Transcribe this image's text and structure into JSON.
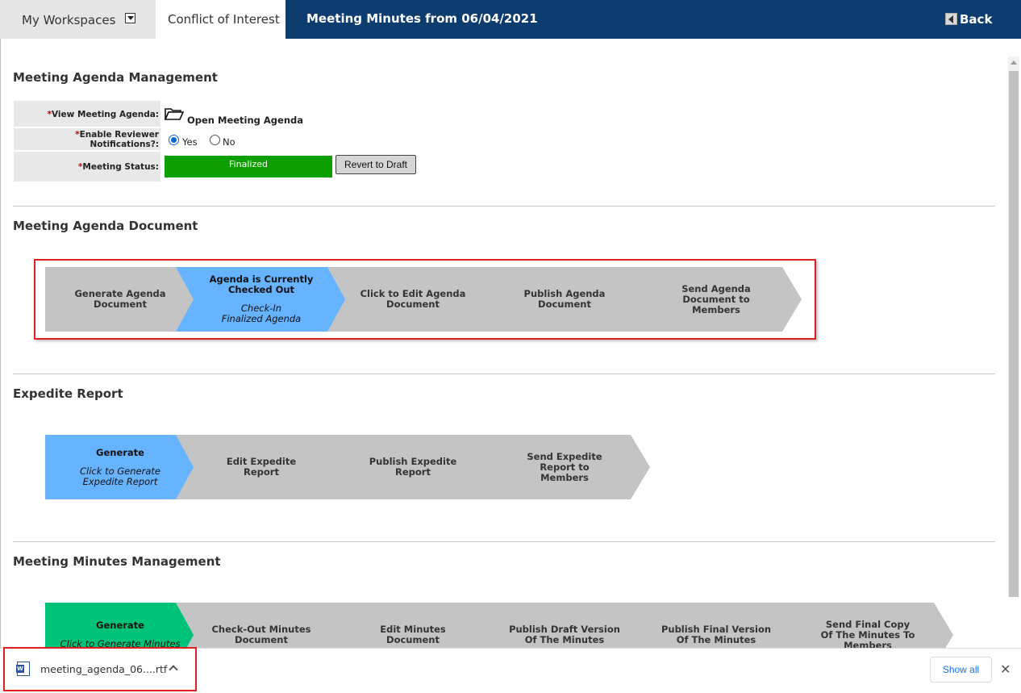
{
  "header": {
    "workspaces_label": "My Workspaces",
    "tab_label": "Conflict of Interest",
    "page_title": "Meeting Minutes from 06/04/2021",
    "back_label": "Back"
  },
  "agenda_management": {
    "title": "Meeting Agenda Management",
    "view_label": "View Meeting Agenda:",
    "open_link": "Open Meeting Agenda",
    "notify_label_1": "Enable Reviewer",
    "notify_label_2": "Notifications?:",
    "yes_label": "Yes",
    "no_label": "No",
    "notify_selected": "Yes",
    "status_label": "Meeting Status:",
    "status_value": "Finalized",
    "revert_label": "Revert to Draft",
    "required_mark": "*"
  },
  "agenda_document": {
    "title": "Meeting Agenda Document",
    "steps": [
      {
        "l1": "Generate Agenda",
        "l2": "Document"
      },
      {
        "l1": "Agenda is Currently",
        "l2": "Checked Out",
        "s1": "Check-In",
        "s2": "Finalized Agenda"
      },
      {
        "l1": "Click to Edit Agenda",
        "l2": "Document"
      },
      {
        "l1": "Publish Agenda",
        "l2": "Document"
      },
      {
        "l1": "Send Agenda",
        "l2": "Document to",
        "l3": "Members"
      }
    ]
  },
  "expedite": {
    "title": "Expedite Report",
    "steps": [
      {
        "l1": "Generate",
        "s1": "Click to Generate",
        "s2": "Expedite Report"
      },
      {
        "l1": "Edit Expedite",
        "l2": "Report"
      },
      {
        "l1": "Publish Expedite",
        "l2": "Report"
      },
      {
        "l1": "Send Expedite",
        "l2": "Report to",
        "l3": "Members"
      }
    ]
  },
  "minutes": {
    "title": "Meeting Minutes Management",
    "steps": [
      {
        "l1": "Generate",
        "s1": "Click to Generate Minutes"
      },
      {
        "l1": "Check-Out Minutes",
        "l2": "Document"
      },
      {
        "l1": "Edit Minutes",
        "l2": "Document"
      },
      {
        "l1": "Publish Draft Version",
        "l2": "Of The Minutes"
      },
      {
        "l1": "Publish Final Version",
        "l2": "Of The Minutes"
      },
      {
        "l1": "Send Final Copy",
        "l2": "Of The Minutes To",
        "l3": "Members"
      }
    ]
  },
  "download_bar": {
    "file_name": "meeting_agenda_06....rtf",
    "show_all": "Show all",
    "close": "✕"
  },
  "colors": {
    "header_bg": "#0d3c6e",
    "finalized": "#0d9f00",
    "active_step": "#66b3ff",
    "generate_minutes": "#00c37a",
    "step_grey": "#c4c4c4",
    "highlight_box": "#e02020"
  }
}
